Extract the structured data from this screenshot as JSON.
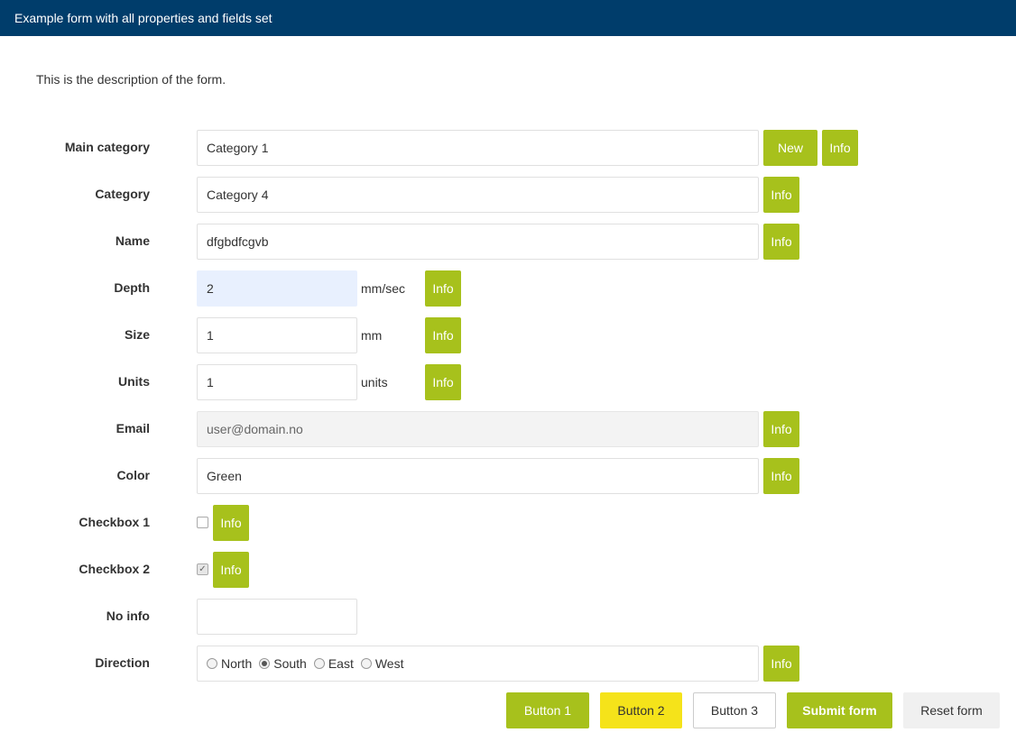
{
  "header": {
    "title": "Example form with all properties and fields set"
  },
  "form": {
    "description": "This is the description of the form.",
    "info_label": "Info",
    "new_label": "New",
    "fields": {
      "main_category": {
        "label": "Main category",
        "value": "Category 1"
      },
      "category": {
        "label": "Category",
        "value": "Category 4"
      },
      "name": {
        "label": "Name",
        "value": "dfgbdfcgvb"
      },
      "depth": {
        "label": "Depth",
        "value": "2",
        "unit": "mm/sec"
      },
      "size": {
        "label": "Size",
        "value": "1",
        "unit": "mm"
      },
      "units": {
        "label": "Units",
        "value": "1",
        "unit": "units"
      },
      "email": {
        "label": "Email",
        "value": "user@domain.no"
      },
      "color": {
        "label": "Color",
        "value": "Green"
      },
      "checkbox1": {
        "label": "Checkbox 1",
        "checked": false
      },
      "checkbox2": {
        "label": "Checkbox 2",
        "checked": true
      },
      "no_info": {
        "label": "No info",
        "value": ""
      },
      "direction": {
        "label": "Direction",
        "options": [
          "North",
          "South",
          "East",
          "West"
        ],
        "selected": "South"
      }
    },
    "buttons": {
      "button1": "Button 1",
      "button2": "Button 2",
      "button3": "Button 3",
      "submit": "Submit form",
      "reset": "Reset form"
    }
  },
  "colors": {
    "header_bg": "#003d6b",
    "accent_green": "#a7c11c",
    "accent_yellow": "#f5e31a"
  }
}
